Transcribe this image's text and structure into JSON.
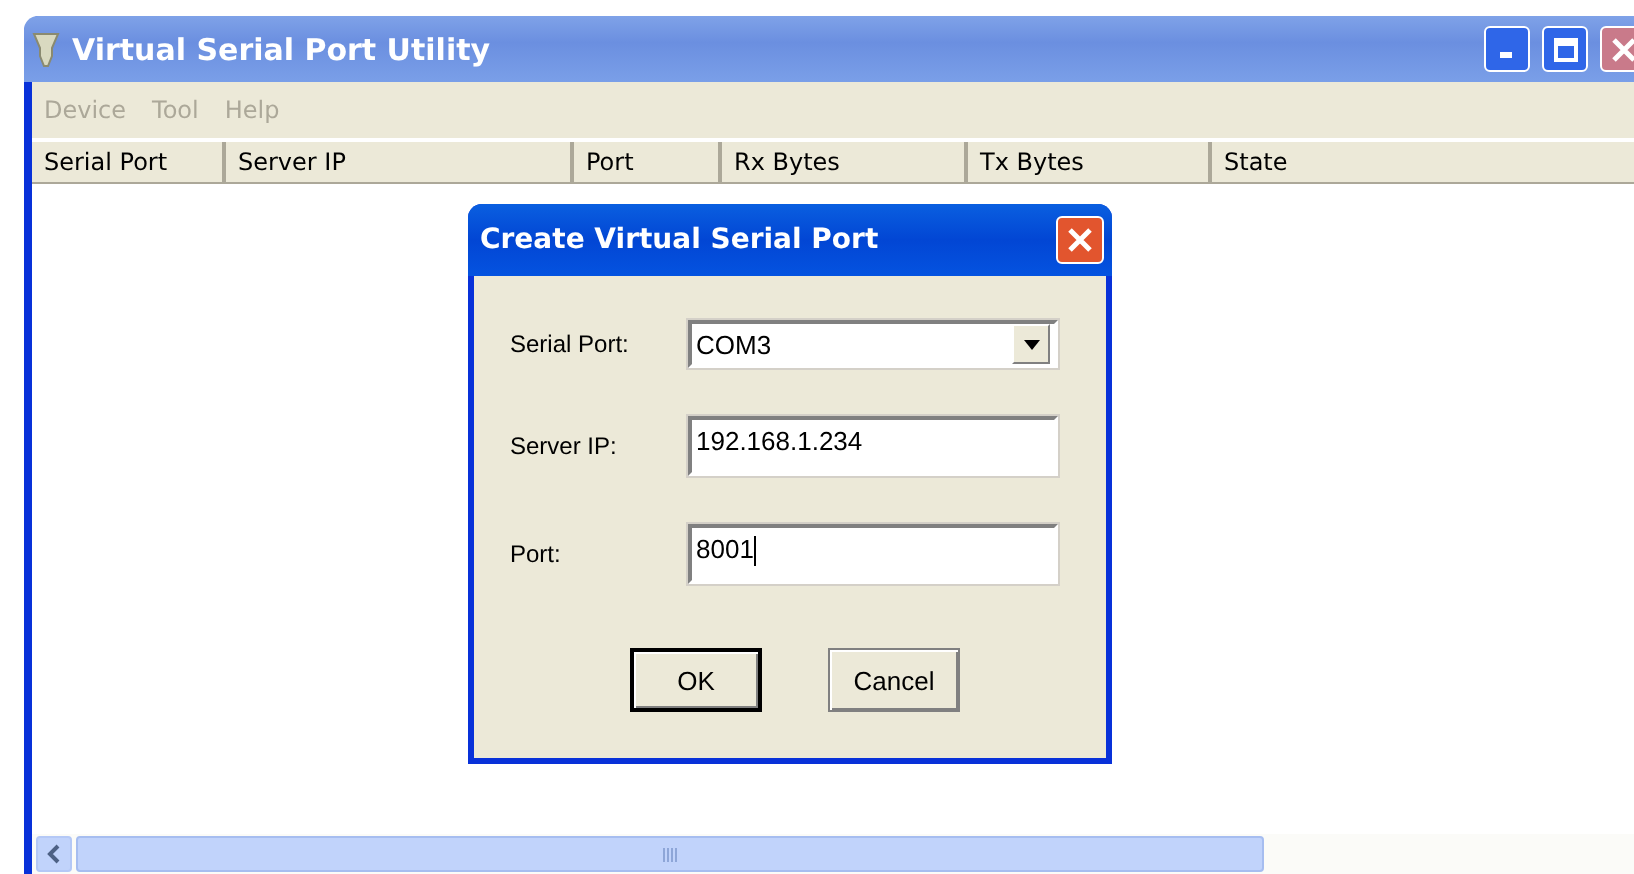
{
  "window": {
    "title": "Virtual Serial Port Utility"
  },
  "menu": [
    {
      "label": "Device",
      "disabled": true
    },
    {
      "label": "Tool",
      "disabled": true
    },
    {
      "label": "Help",
      "disabled": true
    }
  ],
  "table": {
    "columns": [
      "Serial Port",
      "Server IP",
      "Port",
      "Rx Bytes",
      "Tx Bytes",
      "State"
    ]
  },
  "dialog": {
    "title": "Create Virtual Serial Port",
    "fields": [
      {
        "kind": "select",
        "label": "Serial Port:",
        "value": "COM3"
      },
      {
        "kind": "text",
        "label": "Server IP:",
        "value": "192.168.1.234"
      },
      {
        "kind": "text",
        "label": "Port:",
        "value": "8001",
        "focused": true
      }
    ],
    "buttons": [
      {
        "label": "OK",
        "default": true
      },
      {
        "label": "Cancel",
        "default": false
      }
    ]
  }
}
